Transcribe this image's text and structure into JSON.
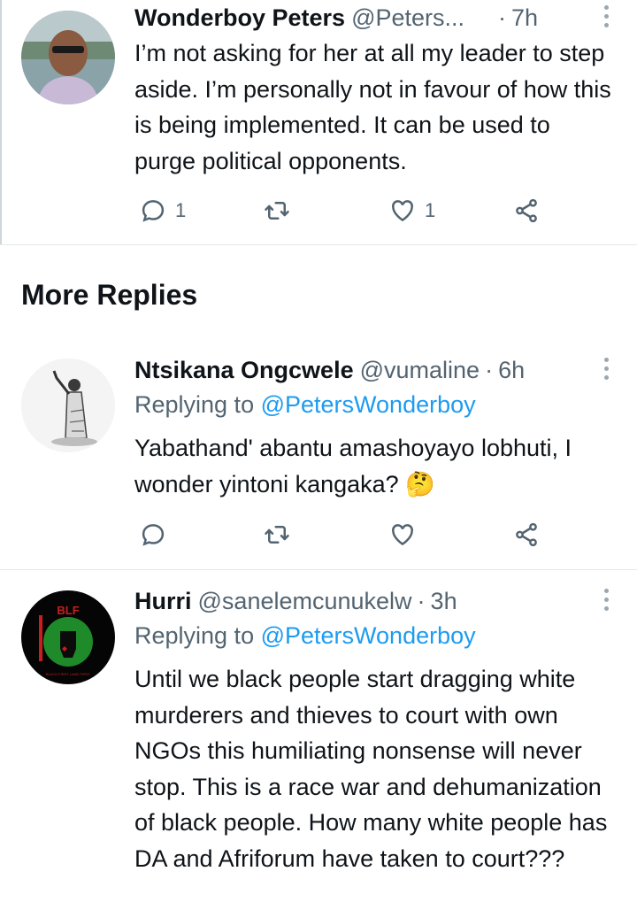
{
  "tweets": [
    {
      "name": "Wonderboy Peters",
      "handle": "@Peters...",
      "time": "7h",
      "body": "I’m not asking for her at all my leader to step aside. I’m personally not in favour of how this is being implemented. It can be used to purge political opponents.",
      "replies": "1",
      "retweets": "",
      "likes": "1"
    }
  ],
  "section_title": "More Replies",
  "replies": [
    {
      "name": "Ntsikana Ongcwele",
      "handle": "@vumaline",
      "time": "6h",
      "replying_prefix": "Replying to ",
      "replying_to": "@PetersWonderboy",
      "body": "Yabathand' abantu amashoyayo lobhuti, I wonder yintoni kangaka? 🤔"
    },
    {
      "name": "Hurri",
      "handle": "@sanelemcunukelw",
      "time": "3h",
      "replying_prefix": "Replying to ",
      "replying_to": "@PetersWonderboy",
      "body": "Until we black people start dragging white murderers and thieves to court with own NGOs this humiliating nonsense will never stop. This is a race war and dehumanization of black people. How many white people has DA and Afriforum have taken to court???",
      "avatar_text": "BLF",
      "avatar_caption": "BLACK FIRST LAND FIRST"
    }
  ],
  "icons": [
    "reply-icon",
    "retweet-icon",
    "like-icon",
    "share-icon",
    "more-icon"
  ],
  "colors": {
    "link": "#1d9bf0",
    "secondary_text": "#536471",
    "text": "#0f1419",
    "divider": "#e6e9eb"
  }
}
